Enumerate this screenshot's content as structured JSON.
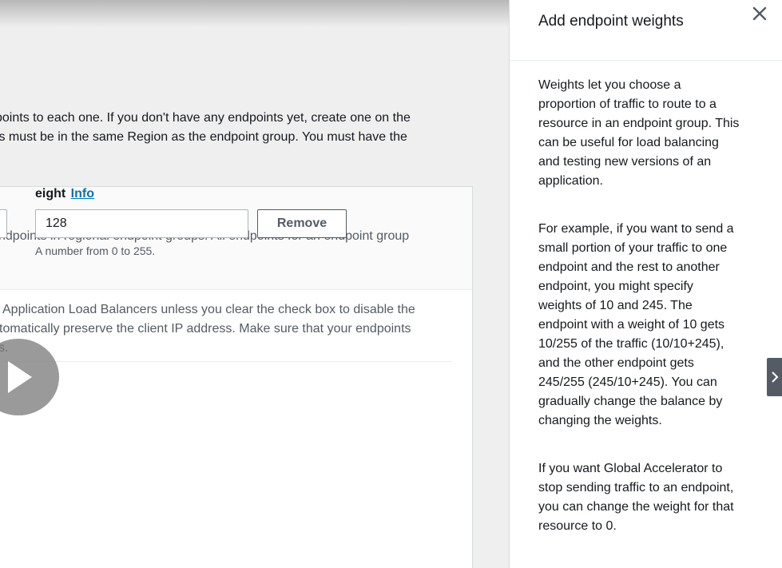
{
  "main": {
    "description_lines": [
      "points to each one. If you don't have any endpoints yet, create one on the",
      "ts must be in the same Region as the endpoint group. You must have the"
    ],
    "card_header_text": "ndpoints in regional endpoint groups. All endpoints for an endpoint group",
    "weight_label": "eight",
    "weight_info_link": "Info",
    "weight_value": "128",
    "remove_label": "Remove",
    "weight_hint": "A number from 0 to 255.",
    "body_lines": [
      " Application Load Balancers unless you clear the check box to disable the",
      "tomatically preserve the client IP address. Make sure that your endpoints",
      "s."
    ]
  },
  "panel": {
    "title": "Add endpoint weights",
    "paragraph1_lines": [
      "Weights let you choose a",
      "proportion of traffic to route to a",
      "resource in an endpoint group. This",
      "can be useful for load balancing",
      "and testing new versions of an",
      "application."
    ],
    "paragraph2_lines": [
      "For example, if you want to send a",
      "small portion of your traffic to one",
      "endpoint and the rest to another",
      "endpoint, you might specify",
      "weights of 10 and 245. The",
      "endpoint with a weight of 10 gets",
      "10/255 of the traffic (10/10+245),",
      "and the other endpoint gets",
      "245/255 (245/10+245). You can",
      "gradually change the balance by",
      "changing the weights."
    ],
    "paragraph3_lines": [
      "If you want Global Accelerator to",
      "stop sending traffic to an endpoint,",
      "you can change the weight for that",
      "resource to 0."
    ]
  },
  "icons": {
    "close": "close-icon",
    "play": "play-icon",
    "chevron": "chevron-right-icon"
  },
  "colors": {
    "link": "#0073bb",
    "text": "#16191f",
    "muted": "#545b64"
  }
}
